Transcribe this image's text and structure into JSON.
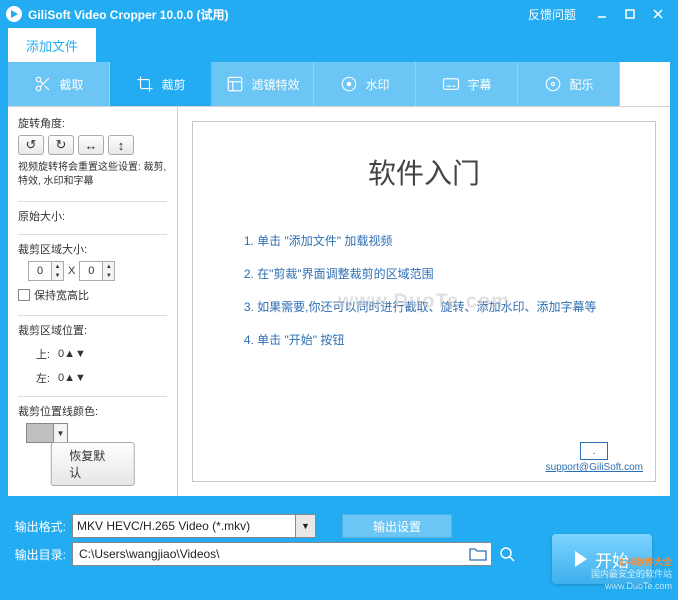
{
  "titlebar": {
    "title": "GiliSoft Video Cropper 10.0.0 (试用)",
    "feedback": "反馈问题"
  },
  "filetab": {
    "label": "添加文件"
  },
  "toolbar": {
    "items": [
      {
        "label": "截取"
      },
      {
        "label": "裁剪"
      },
      {
        "label": "滤镜特效"
      },
      {
        "label": "水印"
      },
      {
        "label": "字幕"
      },
      {
        "label": "配乐"
      }
    ]
  },
  "sidepanel": {
    "rotation_label": "旋转角度:",
    "rotation_note": "视频旋转将会重置这些设置: 裁剪, 特效, 水印和字幕",
    "orig_size_label": "原始大小:",
    "crop_size_label": "裁剪区域大小:",
    "crop_w": "0",
    "crop_h": "0",
    "size_sep": "X",
    "aspect_label": "保持宽高比",
    "crop_pos_label": "裁剪区域位置:",
    "top_label": "上:",
    "top_val": "0",
    "left_label": "左:",
    "left_val": "0",
    "line_color_label": "裁剪位置线颜色:",
    "restore": "恢复默认"
  },
  "preview": {
    "title": "软件入门",
    "steps": [
      "1. 单击 \"添加文件\" 加载视频",
      "2. 在\"剪裁\"界面调整裁剪的区域范围",
      "3. 如果需要,你还可以同时进行截取、旋转、添加水印、添加字幕等",
      "4. 单击 \"开始\" 按钮"
    ],
    "watermark": "www.DuoTe.com",
    "support": "support@GiliSoft.com"
  },
  "footer": {
    "format_label": "输出格式:",
    "format_value": "MKV HEVC/H.265 Video (*.mkv)",
    "settings_btn": "输出设置",
    "dir_label": "输出目录:",
    "dir_value": "C:\\Users\\wangjiao\\Videos\\",
    "start": "开始"
  },
  "corner_wm": {
    "line1": "2 45软件大全",
    "line2": "国内最安全的软件站",
    "line3": "www.DuoTe.com"
  }
}
